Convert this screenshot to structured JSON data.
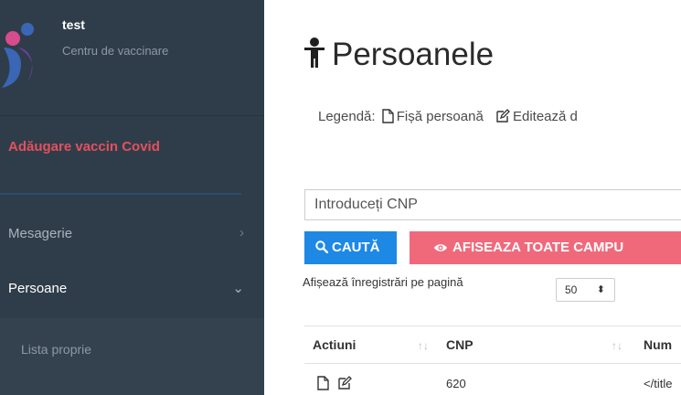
{
  "sidebar": {
    "brand_name": "test",
    "brand_sub": "Centru de vaccinare",
    "covid_link": "Adăugare vaccin Covid",
    "menu": [
      {
        "label": "Mesagerie",
        "chevron": "›"
      },
      {
        "label": "Persoane",
        "chevron": "⌄"
      }
    ],
    "submenu_item": "Lista proprie"
  },
  "main": {
    "title": "Persoanele",
    "legend_prefix": "Legendă:",
    "legend_file": "Fișă persoană",
    "legend_edit": "Editează d",
    "cnp_placeholder": "Introduceți CNP",
    "search_button": "CAUTĂ",
    "fields_button": "AFISEAZA TOATE CAMPU",
    "pagesize_label": "Afișează înregistrări pe pagină",
    "pagesize_value": "50",
    "pagesize_arrows": "⬍"
  },
  "table": {
    "headers": [
      "Actiuni",
      "CNP",
      "Num"
    ],
    "sort_glyph": "↑↓",
    "rows": [
      {
        "cnp": "620",
        "name": "</title"
      }
    ]
  },
  "colors": {
    "sidebar_bg": "#2f3d4a",
    "covid_red": "#e4505e",
    "search_blue": "#1e88e5",
    "fields_pink": "#f0697a"
  },
  "icons": [
    "person-icon",
    "file-icon",
    "edit-icon",
    "search-icon",
    "eye-icon",
    "logo-icon"
  ]
}
